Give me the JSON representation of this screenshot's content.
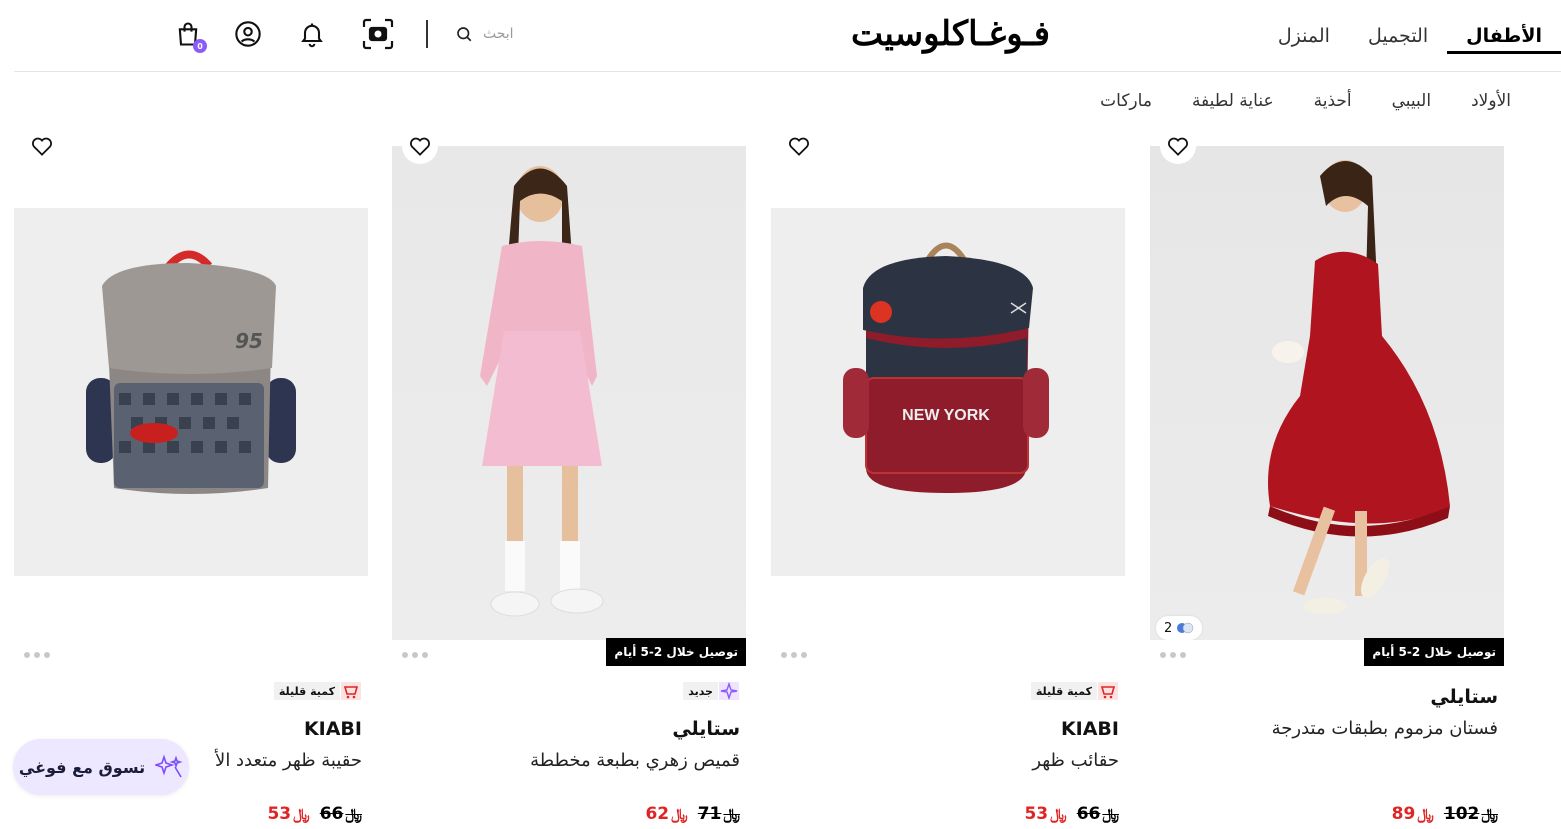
{
  "header": {
    "tabs": [
      {
        "label": "الأطفال",
        "active": true
      },
      {
        "label": "التجميل",
        "active": false
      },
      {
        "label": "المنزل",
        "active": false
      }
    ],
    "logo": "فـوغـاكلوسيت",
    "search_placeholder": "ابحث",
    "cart_count": "0",
    "icons": [
      "search-icon",
      "camera-icon",
      "bell-icon",
      "user-icon",
      "cart-icon"
    ]
  },
  "subnav": [
    "الأولاد",
    "البيبي",
    "أحذية",
    "عناية لطيفة",
    "ماركات"
  ],
  "colors": {
    "accent": "#8b5cf6",
    "sale_red": "#e02424",
    "badge_bg": "#f1f1f1"
  },
  "products": [
    {
      "brand": "ستايلي",
      "name": "فستان مزموم بطبقات متدرجة",
      "delivery": "توصيل خلال 2-5 أيام",
      "color_count": "2",
      "old_price": "102",
      "new_price": "89"
    },
    {
      "brand": "KIABI",
      "name": "حقائب ظهر",
      "badge": "كمية قليلة",
      "old_price": "66",
      "new_price": "53"
    },
    {
      "brand": "ستايلي",
      "name": "قميص زهري بطبعة مخططة",
      "delivery": "توصيل خلال 2-5 أيام",
      "badge": "جديد",
      "old_price": "71",
      "new_price": "62"
    },
    {
      "brand": "KIABI",
      "name": "حقيبة ظهر متعدد الأ",
      "badge": "كمية قليلة",
      "old_price": "66",
      "new_price": "53"
    }
  ],
  "currency_symbol": "ر.س",
  "assistant_button": "تسوق مع فوغي"
}
